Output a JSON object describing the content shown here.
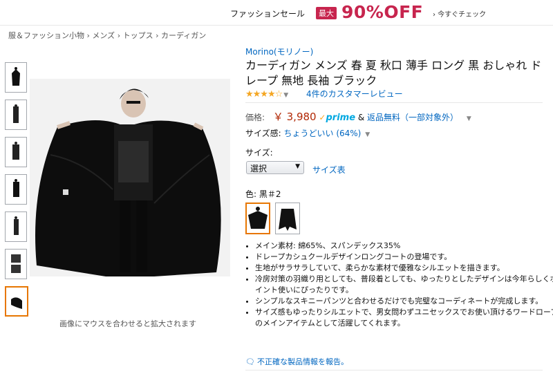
{
  "banner": {
    "sale_text": "ファッションセール",
    "badge": "最大",
    "discount": "90%OFF",
    "check_link": "› 今すぐチェック"
  },
  "breadcrumb": [
    "服＆ファッション小物",
    "メンズ",
    "トップス",
    "カーディガン"
  ],
  "breadcrumb_sep": "›",
  "image": {
    "caption": "画像にマウスを合わせると拡大されます",
    "thumbnail_count": 7,
    "selected_thumbnail": 7
  },
  "product": {
    "brand": "Morino(モリノー)",
    "title": "カーディガン メンズ 春 夏 秋口 薄手 ロング 黒 おしゃれ ドレープ 無地 長袖 ブラック",
    "rating_stars": 4,
    "stars_display": "★★★★☆",
    "reviews_link": "4件のカスタマーレビュー",
    "price_label": "価格:",
    "price": "￥ 3,980",
    "prime": "prime",
    "shipping_amp": "&",
    "shipping": "返品無料（一部対象外）",
    "size_feel_label": "サイズ感:",
    "size_feel_value": "ちょうどいい (64%)",
    "size_label": "サイズ:",
    "size_select": "選択",
    "size_chart": "サイズ表",
    "color_label": "色:",
    "color_value": "黒＃2"
  },
  "bullets": [
    "メイン素材: 綿65%、スパンデックス35%",
    "ドレープカシュクールデザインロングコートの登場です。",
    "生地がサラサラしていて、柔らかな素材で優雅なシルエットを描きます。",
    "冷房対策の羽織り用としても、普段着としても、ゆったりとしたデザインは今年らしくポイント使いにぴったりです。",
    "シンプルなスキニーパンツと合わせるだけでも完璧なコーディネートが完成します。",
    "サイズ感もゆったりシルエットで、男女問わずユニセックスでお使い頂けるワードローブのメインアイテムとして活躍してくれます。"
  ],
  "report_link": "不正確な製品情報を報告。",
  "colors": {
    "link": "#0066c0",
    "price": "#b12704",
    "sale": "#c7254e",
    "stars": "#f4a622",
    "selected_border": "#e77600"
  }
}
